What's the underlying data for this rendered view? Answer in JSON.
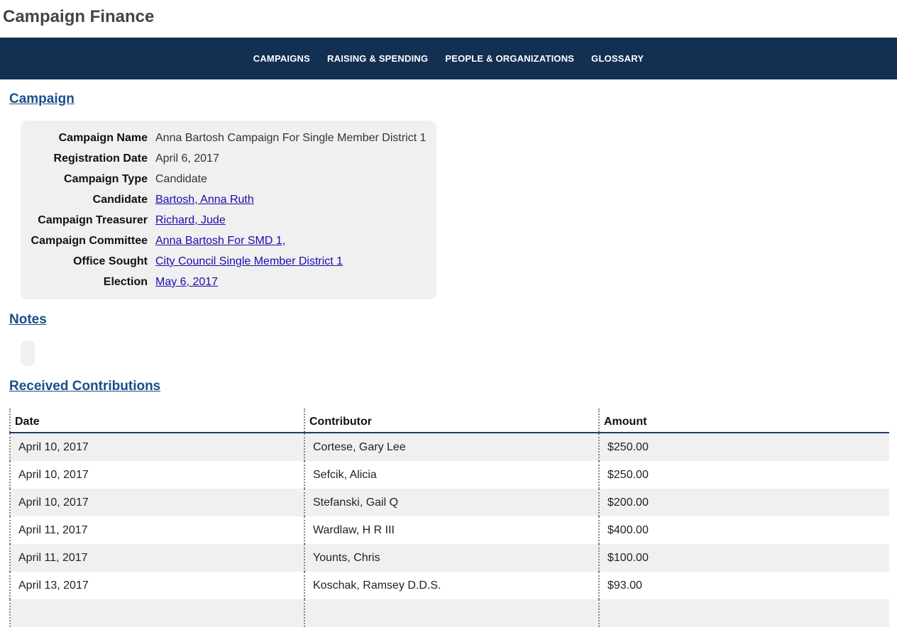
{
  "site": {
    "title": "Campaign Finance"
  },
  "nav": {
    "items": [
      "CAMPAIGNS",
      "RAISING & SPENDING",
      "PEOPLE & ORGANIZATIONS",
      "GLOSSARY"
    ]
  },
  "sections": {
    "campaign": "Campaign",
    "notes": "Notes",
    "contributions": "Received Contributions"
  },
  "campaign": {
    "fields": [
      {
        "label": "Campaign Name",
        "value": "Anna Bartosh Campaign For Single Member District 1",
        "link": false
      },
      {
        "label": "Registration Date",
        "value": "April 6, 2017",
        "link": false
      },
      {
        "label": "Campaign Type",
        "value": "Candidate",
        "link": false
      },
      {
        "label": "Candidate",
        "value": "Bartosh, Anna Ruth",
        "link": true
      },
      {
        "label": "Campaign Treasurer",
        "value": "Richard, Jude",
        "link": true
      },
      {
        "label": "Campaign Committee",
        "value": "Anna Bartosh For SMD 1,",
        "link": true
      },
      {
        "label": "Office Sought",
        "value": "City Council Single Member District 1",
        "link": true
      },
      {
        "label": "Election",
        "value": "May 6, 2017",
        "link": true
      }
    ]
  },
  "contributions": {
    "headers": {
      "date": "Date",
      "contributor": "Contributor",
      "amount": "Amount"
    },
    "rows": [
      {
        "date": "April 10, 2017",
        "contributor": "Cortese, Gary Lee",
        "amount": "$250.00"
      },
      {
        "date": "April 10, 2017",
        "contributor": "Sefcik, Alicia",
        "amount": "$250.00"
      },
      {
        "date": "April 10, 2017",
        "contributor": "Stefanski, Gail Q",
        "amount": "$200.00"
      },
      {
        "date": "April 11, 2017",
        "contributor": "Wardlaw, H R III",
        "amount": "$400.00"
      },
      {
        "date": "April 11, 2017",
        "contributor": "Younts, Chris",
        "amount": "$100.00"
      },
      {
        "date": "April 13, 2017",
        "contributor": "Koschak, Ramsey D.D.S.",
        "amount": "$93.00"
      },
      {
        "date": "",
        "contributor": "",
        "amount": ""
      }
    ]
  },
  "colors": {
    "navbar": "#132f52",
    "heading": "#1a4f8a",
    "link": "#1a0dab",
    "panel": "#f0f0f0"
  }
}
